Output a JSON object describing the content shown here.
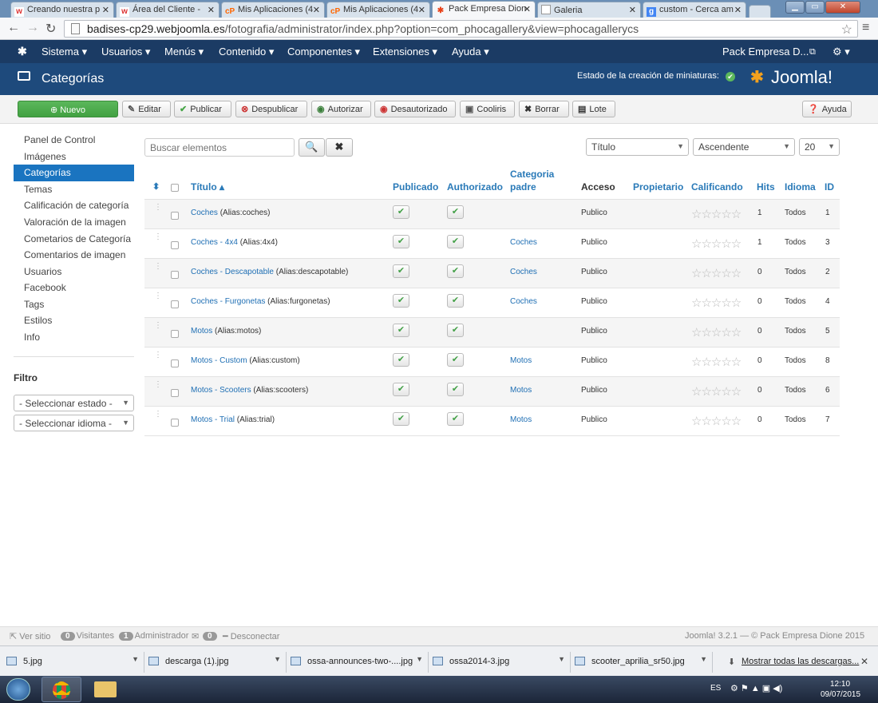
{
  "browser": {
    "tabs": [
      {
        "label": "Creando nuestra p",
        "icon": "w"
      },
      {
        "label": "Área del Cliente - ",
        "icon": "w"
      },
      {
        "label": "Mis Aplicaciones (4",
        "icon": "cP"
      },
      {
        "label": "Mis Aplicaciones (4",
        "icon": "cP"
      },
      {
        "label": "Pack Empresa Dion",
        "icon": "joomla",
        "active": true
      },
      {
        "label": "Galeria",
        "icon": "page"
      },
      {
        "label": "custom - Cerca am",
        "icon": "g"
      }
    ],
    "url_host": "badises-cp29.webjoomla.es",
    "url_path": "/fotografia/administrator/index.php?option=com_phocagallery&view=phocagallerycs"
  },
  "nav": {
    "items": [
      "Sistema ▾",
      "Usuarios ▾",
      "Menús ▾",
      "Contenido ▾",
      "Componentes ▾",
      "Extensiones ▾",
      "Ayuda ▾"
    ],
    "site_name": "Pack Empresa D...",
    "gear": "⚙ ▾"
  },
  "header": {
    "title": "Categorías",
    "thumb_status": "Estado de la creación de miniaturas:",
    "brand": "Joomla!"
  },
  "toolbar": {
    "new": "Nuevo",
    "edit": "Editar",
    "publish": "Publicar",
    "unpublish": "Despublicar",
    "authorize": "Autorizar",
    "unauthorize": "Desautorizado",
    "cooliris": "Cooliris",
    "delete": "Borrar",
    "batch": "Lote",
    "help": "Ayuda"
  },
  "sidebar": {
    "items": [
      "Panel de Control",
      "Imágenes",
      "Categorías",
      "Temas",
      "Calificación de categoría",
      "Valoración de la imagen",
      "Cometarios de Categoría",
      "Comentarios de imagen",
      "Usuarios",
      "Facebook",
      "Tags",
      "Estilos",
      "Info"
    ],
    "active_index": 2,
    "filter_title": "Filtro",
    "state_select": "- Seleccionar estado -",
    "language_select": "- Seleccionar idioma -"
  },
  "search": {
    "placeholder": "Buscar elementos",
    "sort_field": "Título",
    "sort_dir": "Ascendente",
    "limit": "20"
  },
  "table": {
    "headers": {
      "title": "Título ▴",
      "published": "Publicado",
      "authorized": "Authorizado",
      "parent_line1": "Categoria",
      "parent_line2": "padre",
      "access": "Acceso",
      "owner": "Propietario",
      "rating": "Calificando",
      "hits": "Hits",
      "language": "Idioma",
      "id": "ID"
    },
    "rows": [
      {
        "title": "Coches",
        "alias": "(Alias:coches)",
        "parent": "",
        "access": "Publico",
        "hits": "1",
        "language": "Todos",
        "id": "1"
      },
      {
        "title": "Coches - 4x4",
        "alias": "(Alias:4x4)",
        "parent": "Coches",
        "access": "Publico",
        "hits": "1",
        "language": "Todos",
        "id": "3"
      },
      {
        "title": "Coches - Descapotable",
        "alias": "(Alias:descapotable)",
        "parent": "Coches",
        "access": "Publico",
        "hits": "0",
        "language": "Todos",
        "id": "2"
      },
      {
        "title": "Coches - Furgonetas",
        "alias": "(Alias:furgonetas)",
        "parent": "Coches",
        "access": "Publico",
        "hits": "0",
        "language": "Todos",
        "id": "4"
      },
      {
        "title": "Motos",
        "alias": "(Alias:motos)",
        "parent": "",
        "access": "Publico",
        "hits": "0",
        "language": "Todos",
        "id": "5"
      },
      {
        "title": "Motos - Custom",
        "alias": "(Alias:custom)",
        "parent": "Motos",
        "access": "Publico",
        "hits": "0",
        "language": "Todos",
        "id": "8"
      },
      {
        "title": "Motos - Scooters",
        "alias": "(Alias:scooters)",
        "parent": "Motos",
        "access": "Publico",
        "hits": "0",
        "language": "Todos",
        "id": "6"
      },
      {
        "title": "Motos - Trial",
        "alias": "(Alias:trial)",
        "parent": "Motos",
        "access": "Publico",
        "hits": "0",
        "language": "Todos",
        "id": "7"
      }
    ]
  },
  "footer": {
    "view_site": "Ver sitio",
    "visitors_count": "0",
    "visitors": "Visitantes",
    "admin_count": "1",
    "admin": "Administrador",
    "logout_count": "0",
    "logout": "Desconectar",
    "version": "Joomla! 3.2.1 — © Pack Empresa Dione 2015"
  },
  "downloads": {
    "items": [
      "5.jpg",
      "descarga (1).jpg",
      "ossa-announces-two-....jpg",
      "ossa2014-3.jpg",
      "scooter_aprilia_sr50.jpg"
    ],
    "show_all": "Mostrar todas las descargas..."
  },
  "taskbar": {
    "lang": "ES",
    "time": "12:10",
    "date": "09/07/2015"
  }
}
